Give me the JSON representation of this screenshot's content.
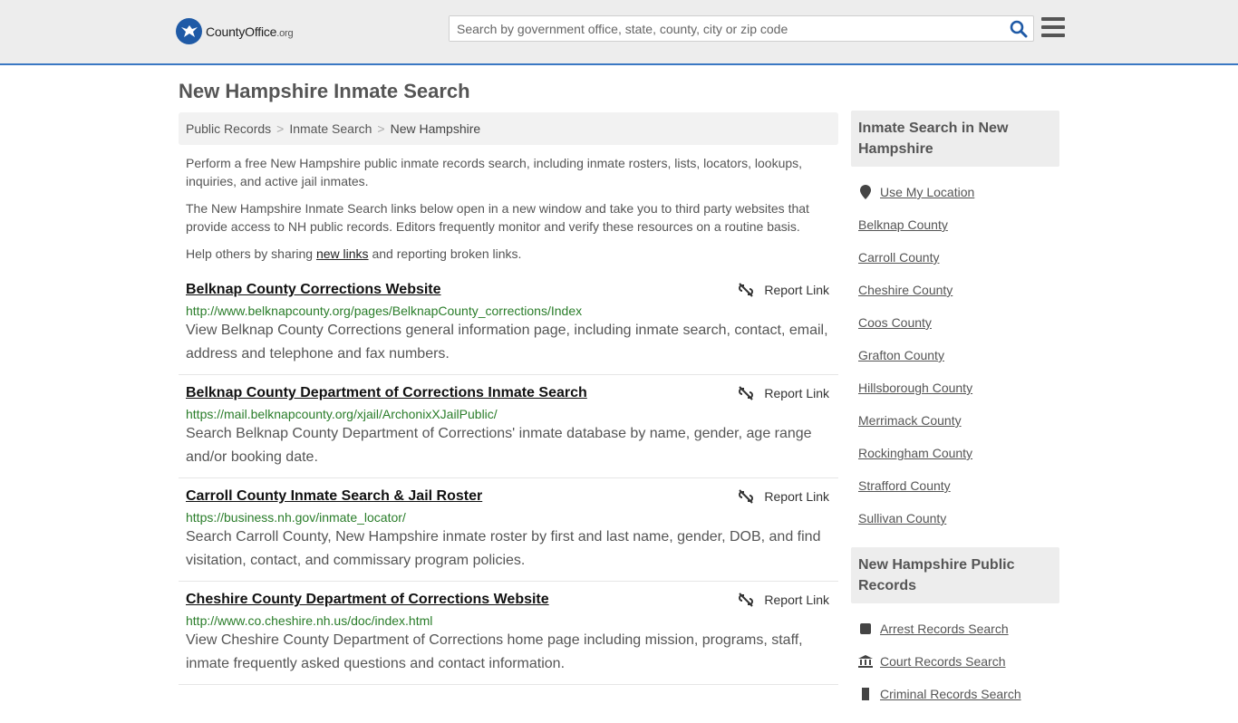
{
  "header": {
    "logo_brand": "CountyOffice",
    "logo_ext": ".org",
    "search_placeholder": "Search by government office, state, county, city or zip code"
  },
  "page_title": "New Hampshire Inmate Search",
  "breadcrumb": [
    "Public Records",
    "Inmate Search",
    "New Hampshire"
  ],
  "intro": {
    "p1": "Perform a free New Hampshire public inmate records search, including inmate rosters, lists, locators, lookups, inquiries, and active jail inmates.",
    "p2": "The New Hampshire Inmate Search links below open in a new window and take you to third party websites that provide access to NH public records. Editors frequently monitor and verify these resources on a routine basis.",
    "p3_before": "Help others by sharing ",
    "p3_link": "new links",
    "p3_after": " and reporting broken links."
  },
  "report_label": "Report Link",
  "results": [
    {
      "title": "Belknap County Corrections Website",
      "url": "http://www.belknapcounty.org/pages/BelknapCounty_corrections/Index",
      "desc": "View Belknap County Corrections general information page, including inmate search, contact, email, address and telephone and fax numbers."
    },
    {
      "title": "Belknap County Department of Corrections Inmate Search",
      "url": "https://mail.belknapcounty.org/xjail/ArchonixXJailPublic/",
      "desc": "Search Belknap County Department of Corrections' inmate database by name, gender, age range and/or booking date."
    },
    {
      "title": "Carroll County Inmate Search & Jail Roster",
      "url": "https://business.nh.gov/inmate_locator/",
      "desc": "Search Carroll County, New Hampshire inmate roster by first and last name, gender, DOB, and find visitation, contact, and commissary program policies."
    },
    {
      "title": "Cheshire County Department of Corrections Website",
      "url": "http://www.co.cheshire.nh.us/doc/index.html",
      "desc": "View Cheshire County Department of Corrections home page including mission, programs, staff, inmate frequently asked questions and contact information."
    }
  ],
  "sidebar": {
    "box1_title": "Inmate Search in New Hampshire",
    "use_location": "Use My Location",
    "counties": [
      "Belknap County",
      "Carroll County",
      "Cheshire County",
      "Coos County",
      "Grafton County",
      "Hillsborough County",
      "Merrimack County",
      "Rockingham County",
      "Strafford County",
      "Sullivan County"
    ],
    "box2_title": "New Hampshire Public Records",
    "records": [
      "Arrest Records Search",
      "Court Records Search",
      "Criminal Records Search"
    ]
  }
}
